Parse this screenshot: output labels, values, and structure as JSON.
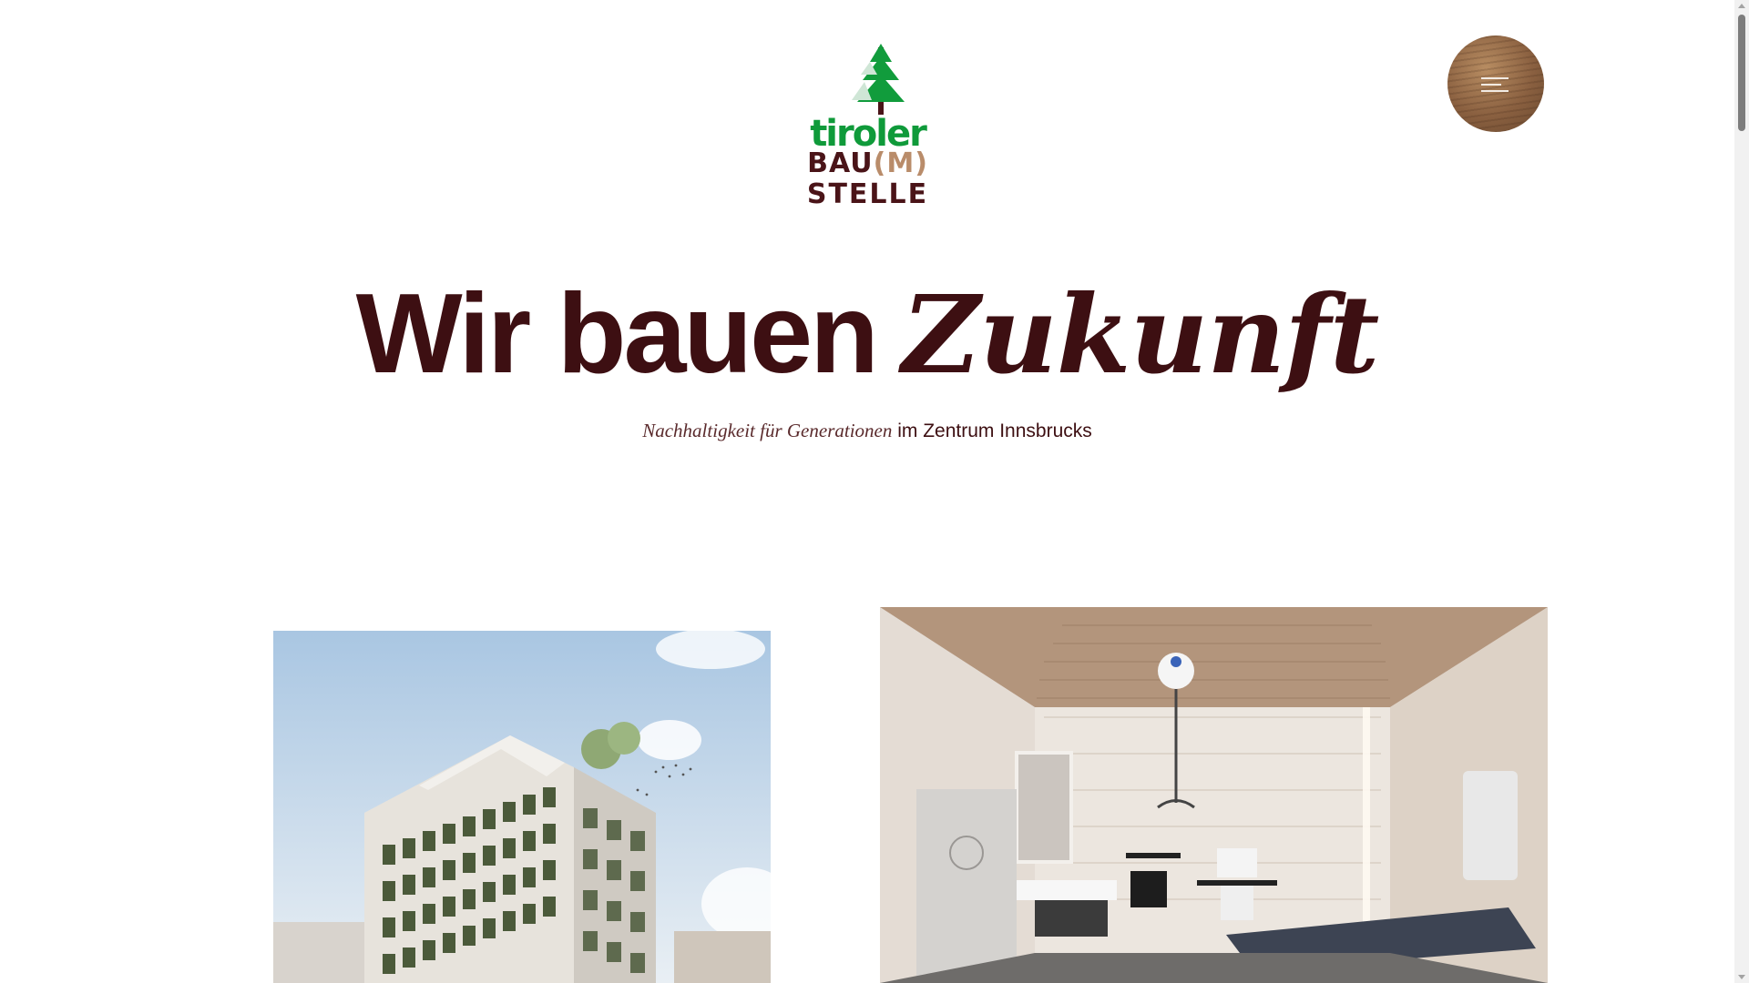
{
  "logo": {
    "line1": "tiroler",
    "line2_a": "BAU",
    "line2_b": "(M)",
    "line3": "STELLE",
    "colors": {
      "green": "#0f9a3a",
      "dark": "#4a1418",
      "wood": "#b98c6a"
    }
  },
  "menu": {
    "icon": "hamburger-icon"
  },
  "hero": {
    "title_plain": "Wir bauen",
    "title_fancy": "Zukunft",
    "subtitle_fancy": "Nachhaltigkeit für Generationen",
    "subtitle_plain": "im Zentrum Innsbrucks"
  },
  "images": [
    {
      "subject": "building-rendering"
    },
    {
      "subject": "accessible-bathroom"
    }
  ],
  "colors": {
    "text": "#3d0f12",
    "background": "#ffffff"
  }
}
